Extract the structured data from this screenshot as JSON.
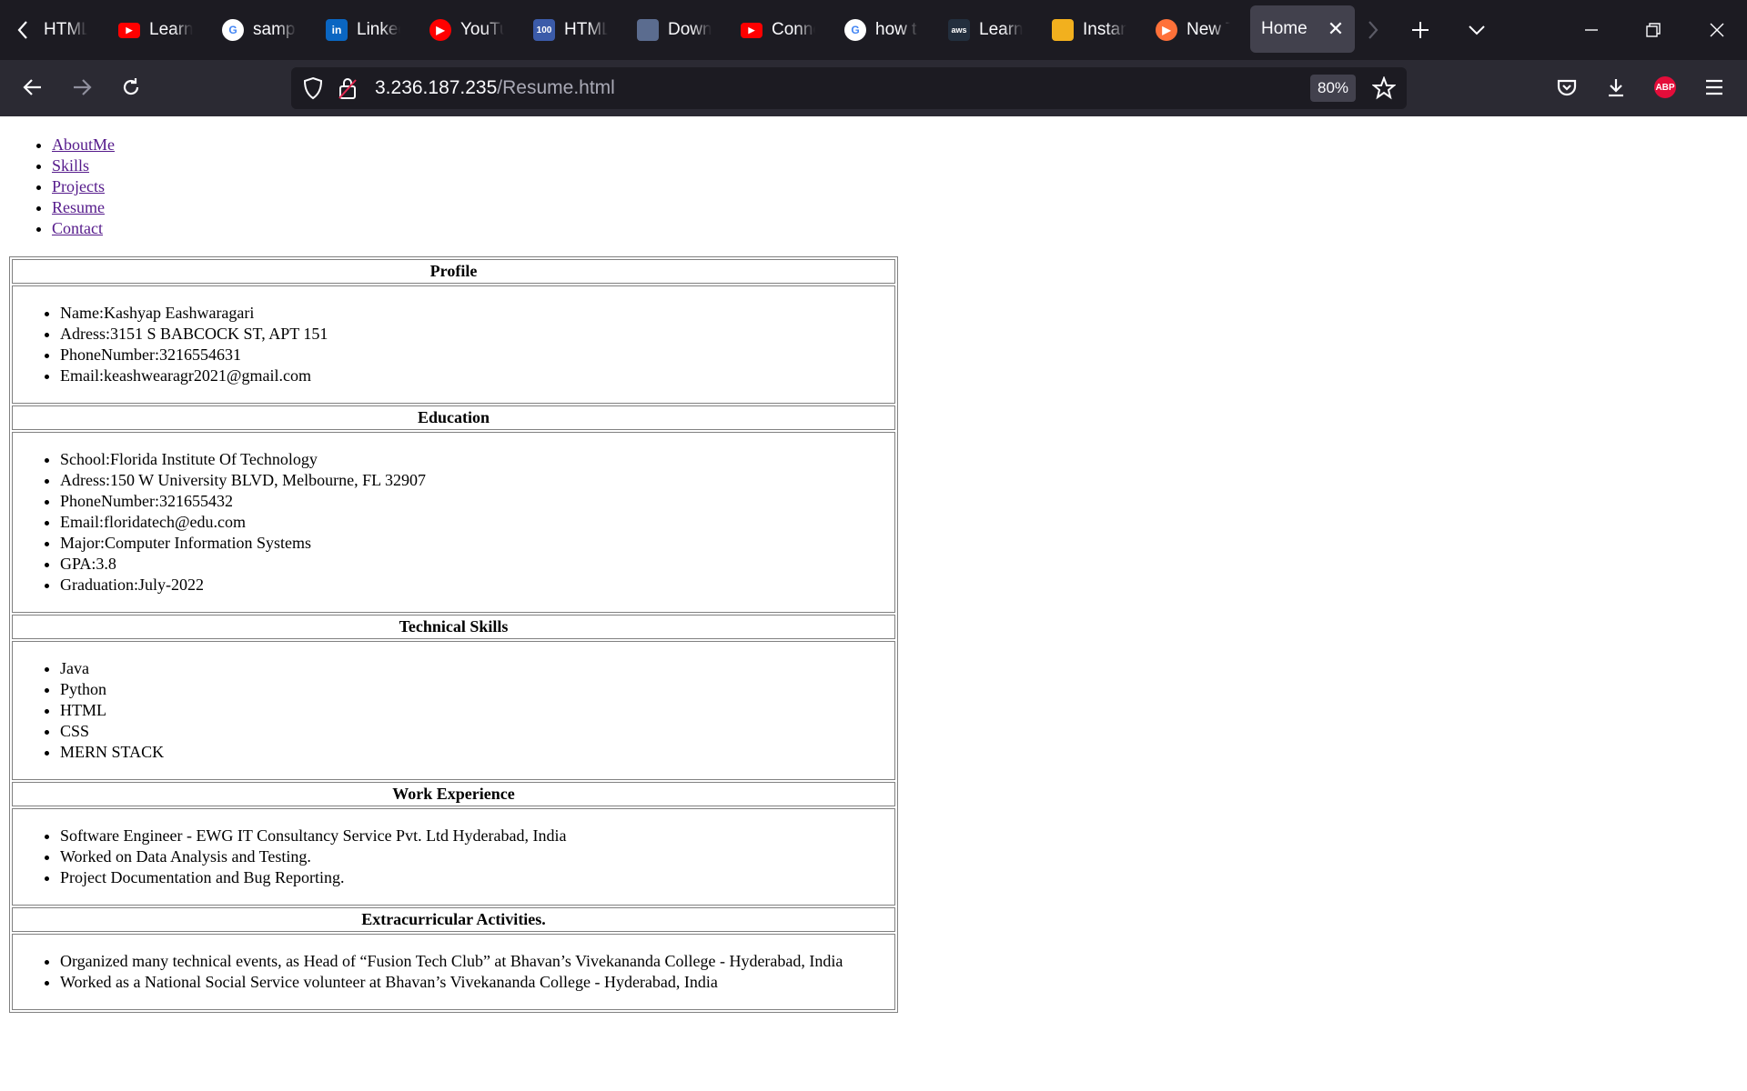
{
  "browser": {
    "tabs": [
      {
        "title": "HTML",
        "icon": "page-icon",
        "color": "#1c1b22"
      },
      {
        "title": "Learn",
        "icon": "youtube-icon",
        "color": "#ff0000"
      },
      {
        "title": "sampl",
        "icon": "google-icon",
        "color": "#ffffff"
      },
      {
        "title": "Linked",
        "icon": "linkedin-icon",
        "color": "#0a66c2"
      },
      {
        "title": "YouTu",
        "icon": "youtube-music-icon",
        "color": "#ff0000"
      },
      {
        "title": "HTML",
        "icon": "w3-100-icon",
        "color": "#3b5ba9"
      },
      {
        "title": "Downl",
        "icon": "download-site-icon",
        "color": "#5b6c8f"
      },
      {
        "title": "Conne",
        "icon": "youtube-icon",
        "color": "#ff0000"
      },
      {
        "title": "how t",
        "icon": "google-icon",
        "color": "#ffffff"
      },
      {
        "title": "Learn",
        "icon": "aws-icon",
        "color": "#232f3e"
      },
      {
        "title": "Instan",
        "icon": "box-icon",
        "color": "#f2b01e"
      },
      {
        "title": "New T",
        "icon": "firefox-icon",
        "color": "#ff7139"
      }
    ],
    "active_tab": {
      "title": "Home"
    },
    "url_host": "3.236.187.235",
    "url_path": "/Resume.html",
    "zoom": "80%",
    "abp_label": "ABP"
  },
  "nav": {
    "links": [
      "AboutMe",
      "Skills",
      "Projects",
      "Resume",
      "Contact"
    ]
  },
  "resume": {
    "sections": [
      {
        "heading": "Profile",
        "items": [
          "Name:Kashyap Eashwaragari",
          "Adress:3151 S BABCOCK ST, APT 151",
          "PhoneNumber:3216554631",
          "Email:keashwearagr2021@gmail.com"
        ]
      },
      {
        "heading": "Education",
        "items": [
          "School:Florida Institute Of Technology",
          "Adress:150 W University BLVD, Melbourne, FL 32907",
          "PhoneNumber:321655432",
          "Email:floridatech@edu.com",
          "Major:Computer Information Systems",
          "GPA:3.8",
          "Graduation:July-2022"
        ]
      },
      {
        "heading": "Technical Skills",
        "items": [
          "Java",
          "Python",
          "HTML",
          "CSS",
          "MERN STACK"
        ]
      },
      {
        "heading": "Work Experience",
        "items": [
          "Software Engineer - EWG IT Consultancy Service Pvt. Ltd Hyderabad, India",
          "Worked on Data Analysis and Testing.",
          "Project Documentation and Bug Reporting."
        ]
      },
      {
        "heading": "Extracurricular Activities.",
        "items": [
          "Organized many technical events, as Head of “Fusion Tech Club” at Bhavan’s Vivekananda College - Hyderabad, India",
          "Worked as a National Social Service volunteer at Bhavan’s Vivekananda College - Hyderabad, India"
        ]
      }
    ]
  }
}
